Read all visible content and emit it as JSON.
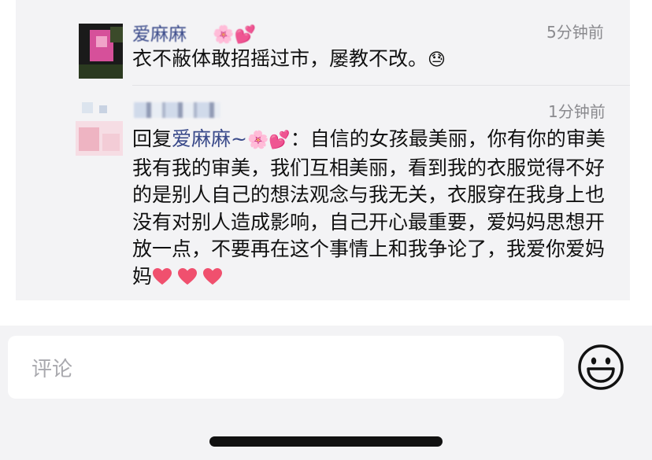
{
  "comments": [
    {
      "author": "爱麻麻",
      "author_emoji": "🌸💕",
      "time": "5分钟前",
      "text": "衣不蔽体敢招摇过市，屡教不改。",
      "text_emoji": "😓"
    },
    {
      "time": "1分钟前",
      "reply_prefix": "回复",
      "reply_to": "爱麻麻~",
      "reply_to_emoji": "🌸💕",
      "reply_colon": "：",
      "text": "自信的女孩最美丽，你有你的审美我有我的审美，我们互相美丽，看到我的衣服觉得不好的是别人自己的想法观念与我无关，衣服穿在我身上也没有对别人造成影响，自己开心最重要，爱妈妈思想开放一点，不要再在这个事情上和我争论了，我爱你爱妈妈"
    }
  ],
  "comment_input": {
    "placeholder": "评论"
  },
  "icons": {
    "emoji_button": "smiley-face-icon",
    "heart": "red-heart-icon"
  },
  "colors": {
    "link_name": "#3a4a8a",
    "thread_bg": "#f3f3f5",
    "heart": "#f0506e"
  }
}
